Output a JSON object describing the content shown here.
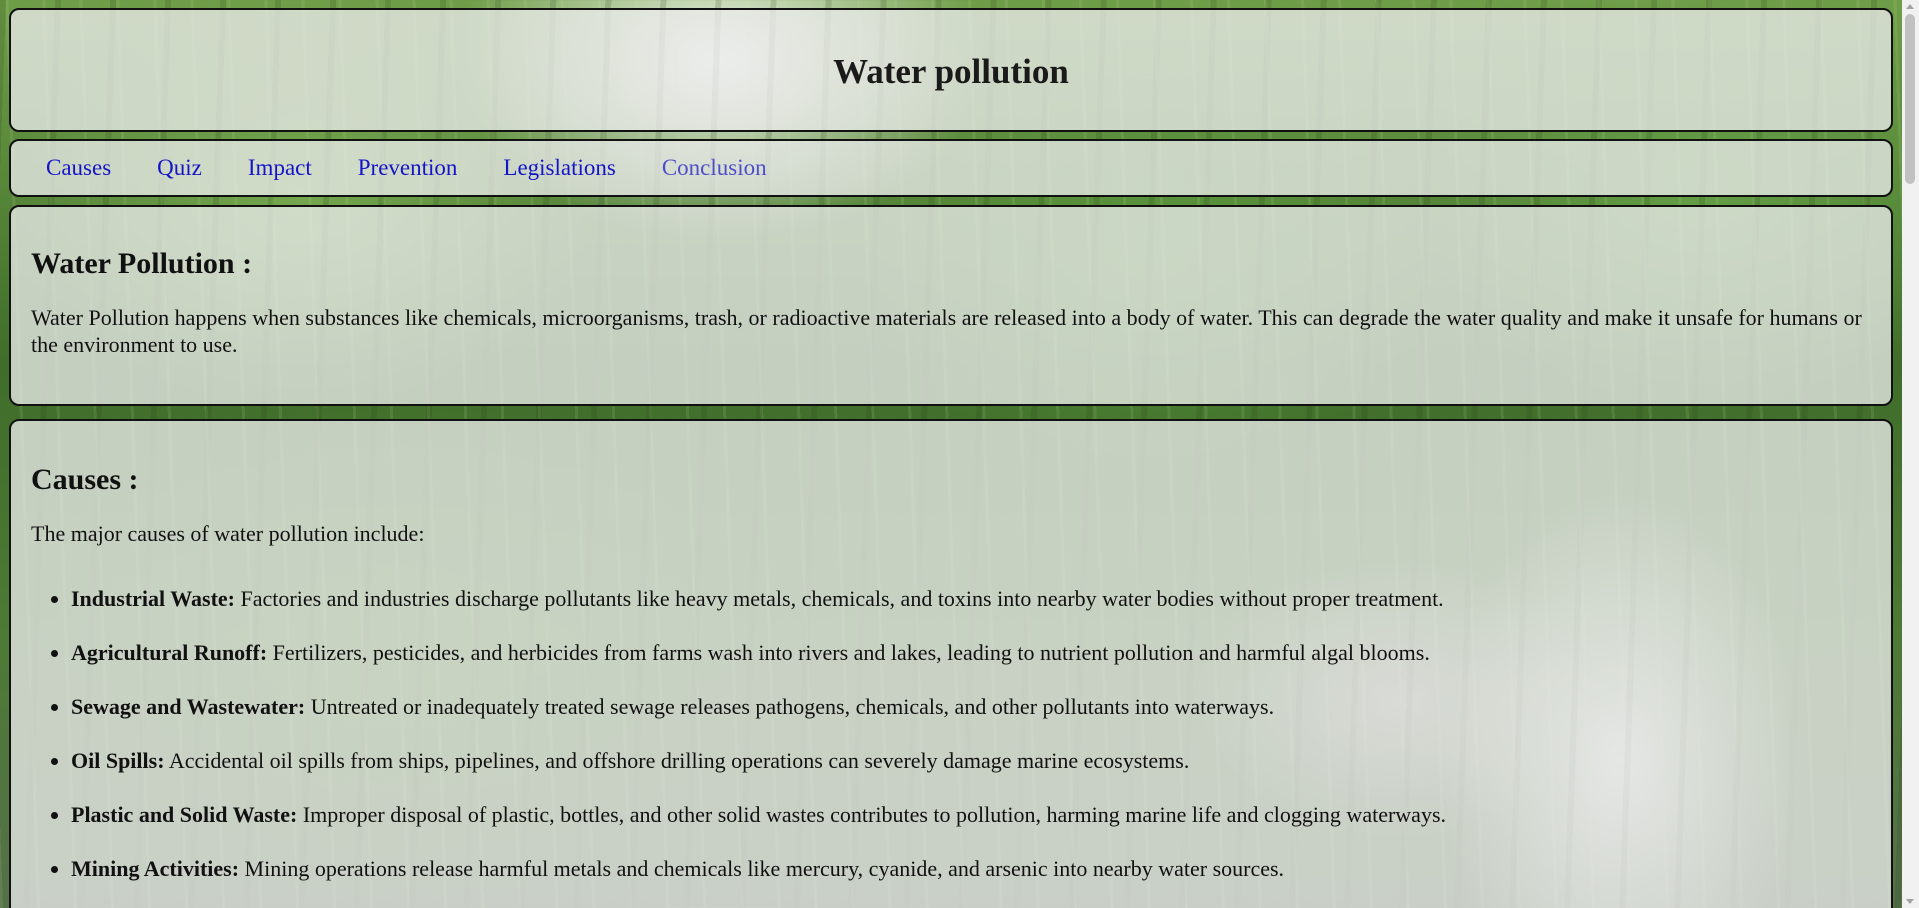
{
  "header": {
    "title": "Water pollution"
  },
  "nav": {
    "items": [
      {
        "label": "Causes"
      },
      {
        "label": "Quiz"
      },
      {
        "label": "Impact"
      },
      {
        "label": "Prevention"
      },
      {
        "label": "Legislations"
      },
      {
        "label": "Conclusion"
      }
    ]
  },
  "intro": {
    "heading": "Water Pollution :",
    "text": "Water Pollution happens when substances like chemicals, microorganisms, trash, or radioactive materials are released into a body of water. This can degrade the water quality and make it unsafe for humans or the environment to use."
  },
  "causes": {
    "heading": "Causes :",
    "lead": "The major causes of water pollution include:",
    "items": [
      {
        "term": "Industrial Waste:",
        "desc": " Factories and industries discharge pollutants like heavy metals, chemicals, and toxins into nearby water bodies without proper treatment."
      },
      {
        "term": "Agricultural Runoff:",
        "desc": " Fertilizers, pesticides, and herbicides from farms wash into rivers and lakes, leading to nutrient pollution and harmful algal blooms."
      },
      {
        "term": "Sewage and Wastewater:",
        "desc": " Untreated or inadequately treated sewage releases pathogens, chemicals, and other pollutants into waterways."
      },
      {
        "term": "Oil Spills:",
        "desc": " Accidental oil spills from ships, pipelines, and offshore drilling operations can severely damage marine ecosystems."
      },
      {
        "term": "Plastic and Solid Waste:",
        "desc": " Improper disposal of plastic, bottles, and other solid wastes contributes to pollution, harming marine life and clogging waterways."
      },
      {
        "term": "Mining Activities:",
        "desc": " Mining operations release harmful metals and chemicals like mercury, cyanide, and arsenic into nearby water sources."
      }
    ]
  },
  "colors": {
    "link": "#1414c8",
    "panel_bg": "rgba(235,235,235,0.78)",
    "border": "#111111"
  }
}
